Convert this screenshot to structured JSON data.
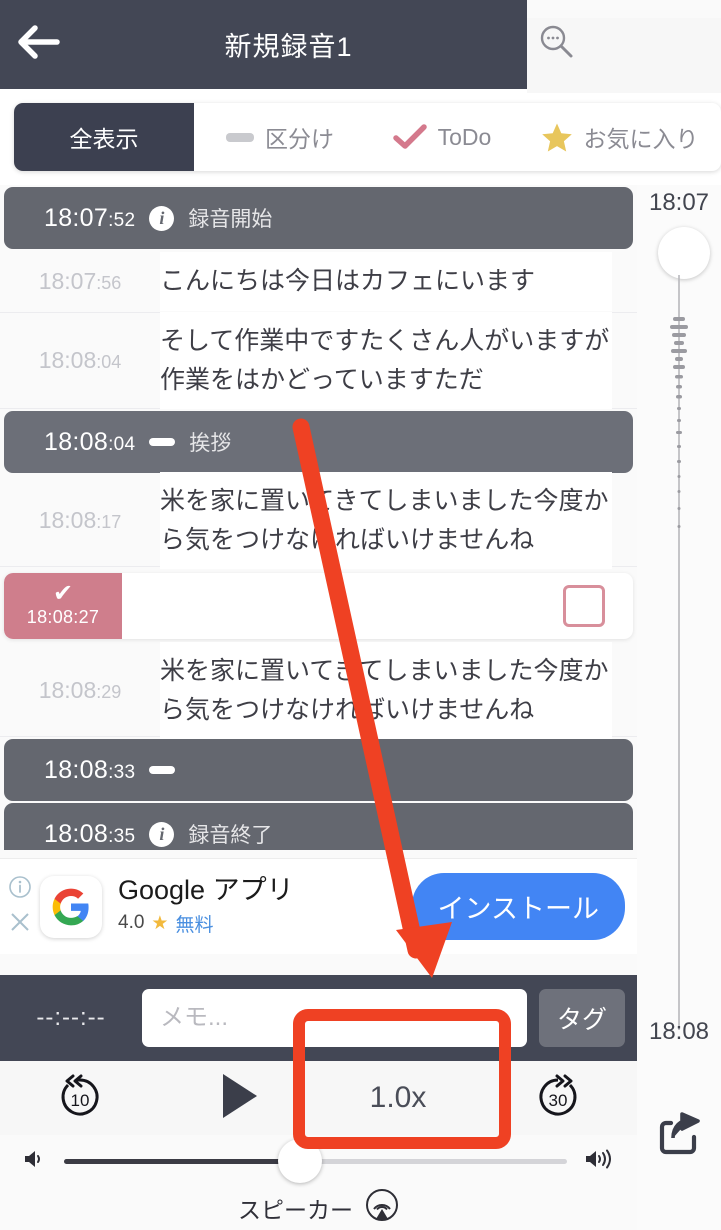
{
  "header": {
    "title": "新規録音1",
    "back_icon": "back-arrow-icon",
    "search_icon": "search-icon"
  },
  "tabs": [
    {
      "label": "全表示",
      "icon": "none",
      "active": true
    },
    {
      "label": "区分け",
      "icon": "dash-icon",
      "active": false
    },
    {
      "label": "ToDo",
      "icon": "check-icon",
      "active": false
    },
    {
      "label": "お気に入り",
      "icon": "star-icon",
      "active": false
    }
  ],
  "transcript": [
    {
      "kind": "marker",
      "time": "18:07",
      "ms": ":52",
      "icon": "info-icon",
      "label": "録音開始"
    },
    {
      "kind": "text",
      "time": "18:07",
      "ms": ":56",
      "text": "こんにちは今日はカフェにいます"
    },
    {
      "kind": "text",
      "time": "18:08",
      "ms": ":04",
      "text": "そして作業中ですたくさん人がいますが作業をはかどっていますただ"
    },
    {
      "kind": "marker",
      "time": "18:08",
      "ms": ":04",
      "icon": "dash-icon",
      "label": "挨拶"
    },
    {
      "kind": "text",
      "time": "18:08",
      "ms": ":17",
      "text": "米を家に置いてきてしまいました今度から気をつけなければいけませんね"
    },
    {
      "kind": "todo",
      "time": "18:08:27",
      "check": "✔",
      "text": ""
    },
    {
      "kind": "text",
      "time": "18:08",
      "ms": ":29",
      "text": "米を家に置いてきてしまいました今度から気をつけなければいけませんね"
    },
    {
      "kind": "marker",
      "time": "18:08",
      "ms": ":33",
      "icon": "dash-icon",
      "label": ""
    },
    {
      "kind": "marker",
      "time": "18:08",
      "ms": ":35",
      "icon": "info-icon",
      "label": "録音終了"
    }
  ],
  "ad": {
    "info_icon": "info-circle-icon",
    "close_icon": "close-icon",
    "logo_icon": "google-g-icon",
    "title": "Google アプリ",
    "rating": "4.0",
    "star_icon": "star-icon",
    "price": "無料",
    "cta": "インストール"
  },
  "memobar": {
    "time": "--:--:--",
    "memo_placeholder": "メモ...",
    "memo_value": "",
    "tag_label": "タグ"
  },
  "transport": {
    "rewind_label": "10",
    "rewind_icon": "rewind-10-icon",
    "play_icon": "play-icon",
    "speed": "1.0x",
    "forward_label": "30",
    "forward_icon": "forward-30-icon"
  },
  "volume": {
    "mute_icon": "volume-low-icon",
    "max_icon": "volume-high-icon",
    "level_percent": 47
  },
  "speaker": {
    "label": "スピーカー",
    "icon": "airplay-icon"
  },
  "rail": {
    "time_top": "18:07",
    "time_bottom": "18:08",
    "scrubber_icon": "scrubber-knob",
    "share_icon": "share-icon"
  },
  "colors": {
    "header_bg": "#434755",
    "marker_bg": "#6c6f78",
    "accent_red": "#ef4123",
    "todo_pink": "#cf7e8c",
    "cta_blue": "#4285f4",
    "star_gold": "#e8c65c"
  },
  "annotations": {
    "arrow": "red-arrow",
    "highlight_box": "red-rectangle"
  }
}
